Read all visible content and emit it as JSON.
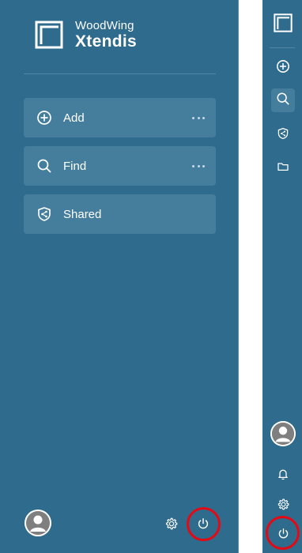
{
  "brand": {
    "company": "WoodWing",
    "product": "Xtendis",
    "logo_icon": "xtendis-logo-icon"
  },
  "nav": {
    "items": [
      {
        "label": "Add",
        "icon": "plus-circle-icon",
        "has_more": true
      },
      {
        "label": "Find",
        "icon": "search-icon",
        "has_more": true
      },
      {
        "label": "Shared",
        "icon": "shield-share-icon",
        "has_more": false
      }
    ]
  },
  "footer": {
    "avatar": "user-avatar",
    "settings_icon": "gear-icon",
    "power_icon": "power-icon",
    "highlight_color": "#e50914"
  },
  "rail": {
    "items": [
      {
        "icon": "plus-circle-icon"
      },
      {
        "icon": "search-icon",
        "active": true
      },
      {
        "icon": "shield-share-icon"
      },
      {
        "icon": "folder-icon"
      }
    ],
    "bottom": [
      "user-avatar",
      "bell-icon",
      "gear-icon",
      "power-icon"
    ]
  },
  "colors": {
    "panel_bg": "#2e6b8c",
    "item_bg": "#447e9c",
    "text": "#ffffff"
  }
}
